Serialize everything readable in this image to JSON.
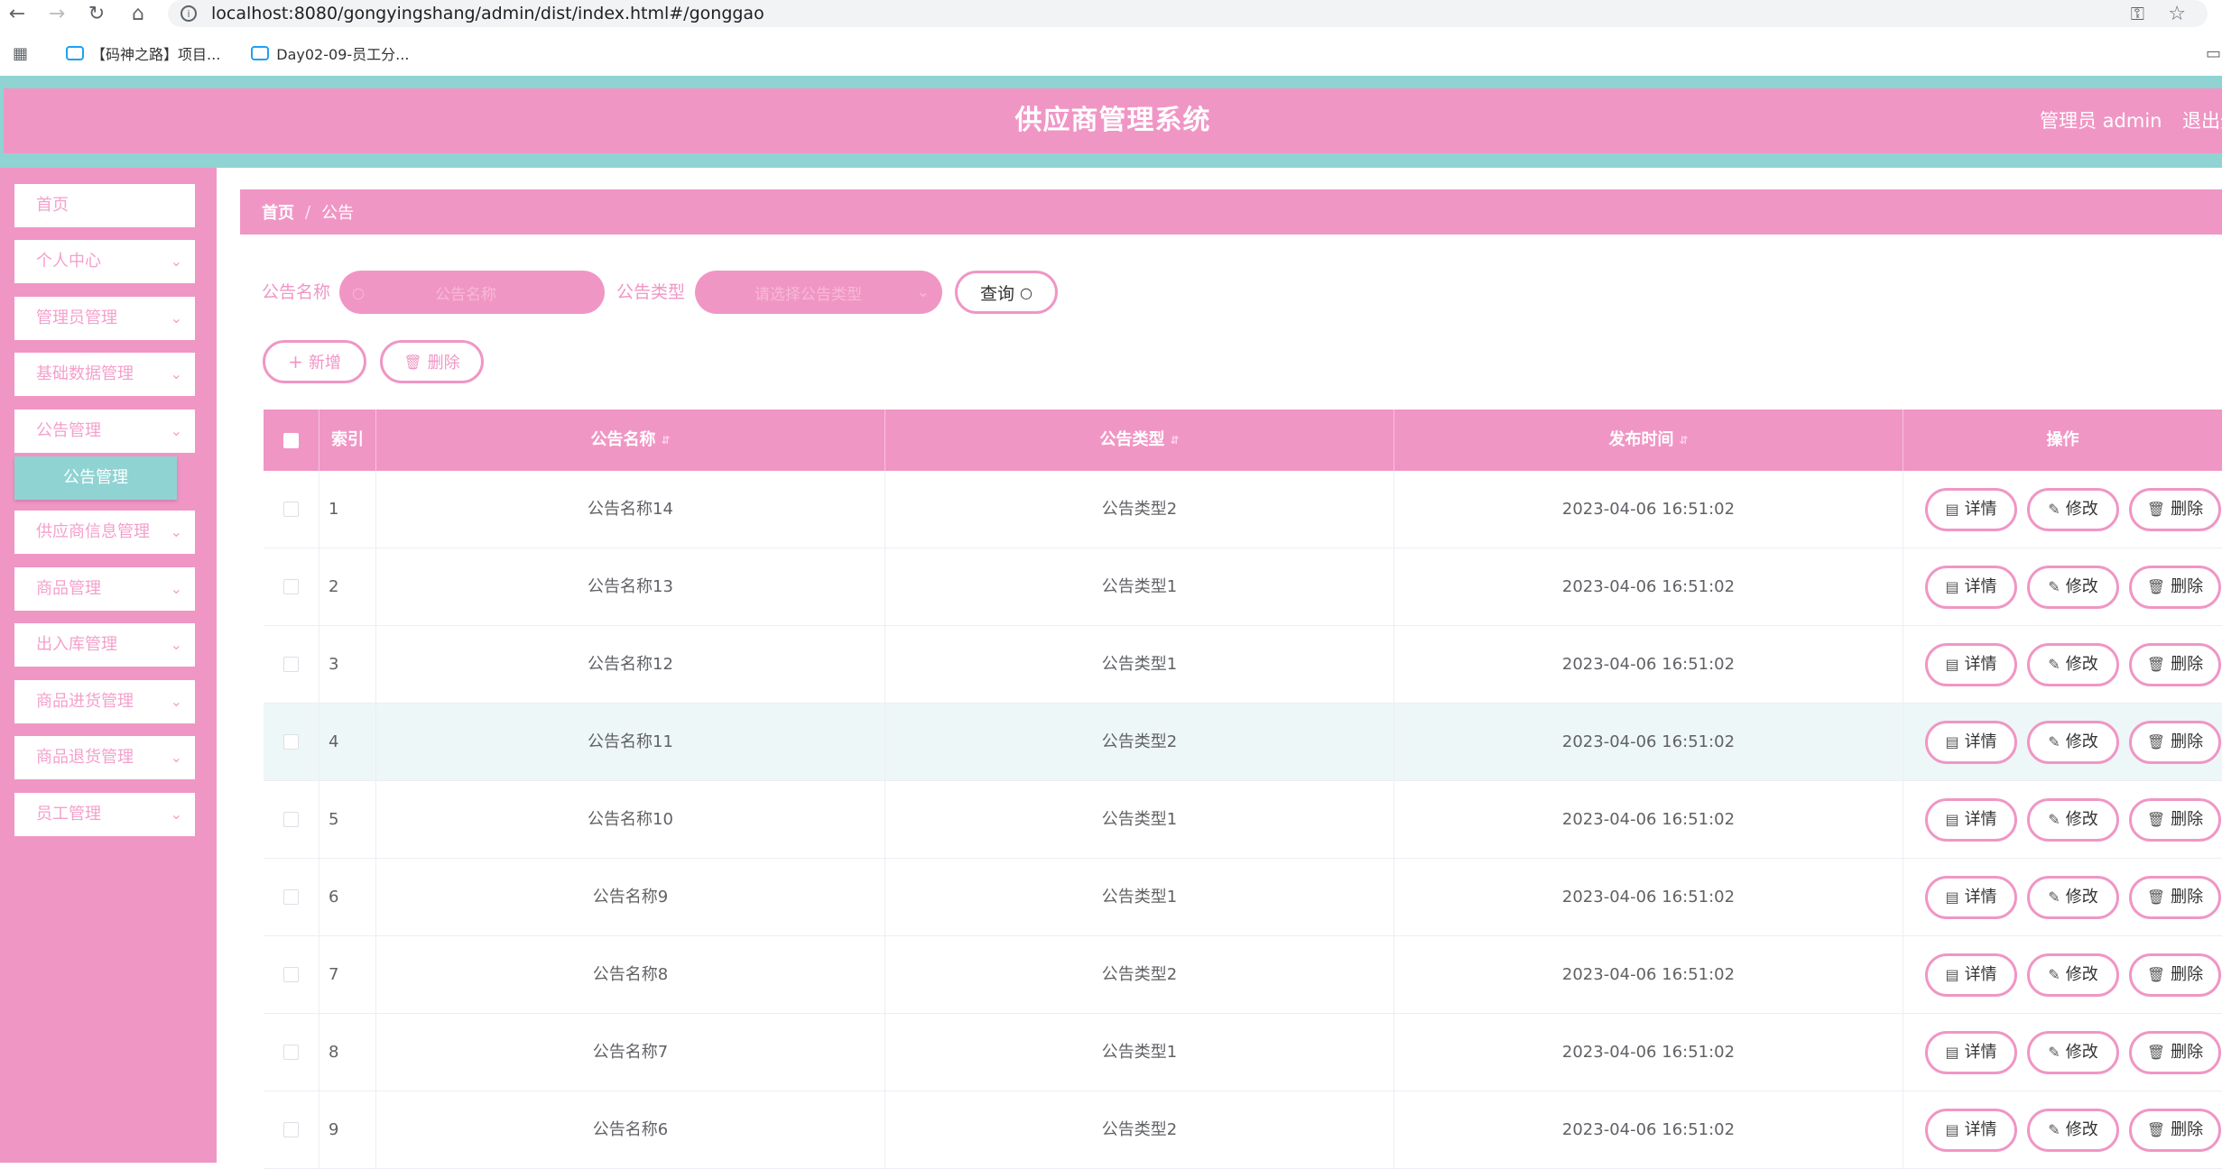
{
  "browser": {
    "url": "localhost:8080/gongyingshang/admin/dist/index.html#/gonggao",
    "bookmarks": [
      "【码神之路】项目...",
      "Day02-09-员工分..."
    ]
  },
  "header": {
    "title": "供应商管理系统",
    "user": "管理员 admin",
    "logout": "退出登录"
  },
  "sidebar": {
    "items": [
      {
        "label": "首页"
      },
      {
        "label": "个人中心"
      },
      {
        "label": "管理员管理"
      },
      {
        "label": "基础数据管理"
      },
      {
        "label": "公告管理"
      },
      {
        "label": "供应商信息管理"
      },
      {
        "label": "商品管理"
      },
      {
        "label": "出入库管理"
      },
      {
        "label": "商品进货管理"
      },
      {
        "label": "商品退货管理"
      },
      {
        "label": "员工管理"
      }
    ],
    "sub_active": "公告管理"
  },
  "breadcrumb": {
    "home": "首页",
    "sep": "/",
    "current": "公告"
  },
  "search": {
    "name_label": "公告名称",
    "name_placeholder": "公告名称",
    "type_label": "公告类型",
    "type_placeholder": "请选择公告类型",
    "query_label": "查询"
  },
  "actions": {
    "add_label": "新增",
    "delete_label": "删除"
  },
  "table": {
    "headers": {
      "index": "索引",
      "name": "公告名称",
      "type": "公告类型",
      "time": "发布时间",
      "ops": "操作"
    },
    "op_labels": {
      "detail": "详情",
      "edit": "修改",
      "delete": "删除"
    },
    "rows": [
      {
        "index": "1",
        "name": "公告名称14",
        "type": "公告类型2",
        "time": "2023-04-06 16:51:02"
      },
      {
        "index": "2",
        "name": "公告名称13",
        "type": "公告类型1",
        "time": "2023-04-06 16:51:02"
      },
      {
        "index": "3",
        "name": "公告名称12",
        "type": "公告类型1",
        "time": "2023-04-06 16:51:02"
      },
      {
        "index": "4",
        "name": "公告名称11",
        "type": "公告类型2",
        "time": "2023-04-06 16:51:02"
      },
      {
        "index": "5",
        "name": "公告名称10",
        "type": "公告类型1",
        "time": "2023-04-06 16:51:02"
      },
      {
        "index": "6",
        "name": "公告名称9",
        "type": "公告类型1",
        "time": "2023-04-06 16:51:02"
      },
      {
        "index": "7",
        "name": "公告名称8",
        "type": "公告类型2",
        "time": "2023-04-06 16:51:02"
      },
      {
        "index": "8",
        "name": "公告名称7",
        "type": "公告类型1",
        "time": "2023-04-06 16:51:02"
      },
      {
        "index": "9",
        "name": "公告名称6",
        "type": "公告类型2",
        "time": "2023-04-06 16:51:02"
      }
    ]
  },
  "colors": {
    "accent": "#f096c5",
    "teal": "#8fd3d3"
  }
}
